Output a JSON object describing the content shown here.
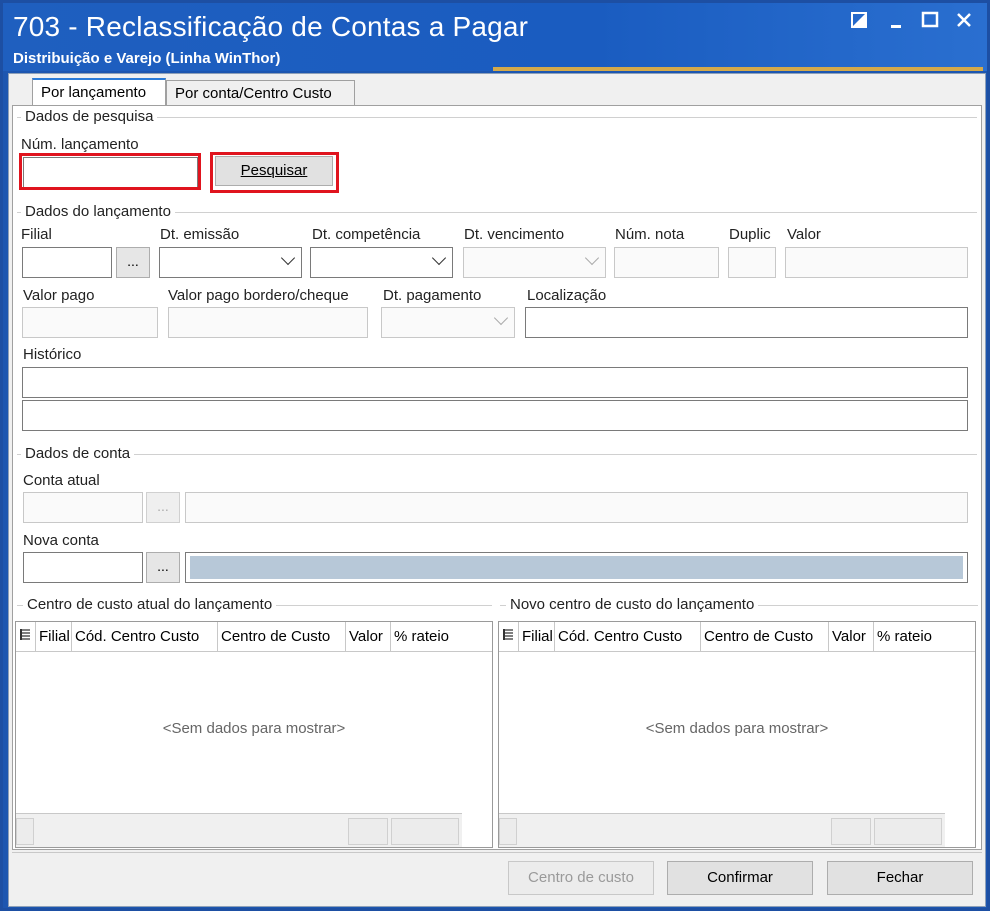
{
  "window": {
    "title": "703 - Reclassificação de Contas a Pagar",
    "subtitle": "Distribuição e Varejo (Linha WinThor)"
  },
  "tabs": [
    {
      "label": "Por lançamento"
    },
    {
      "label": "Por conta/Centro Custo"
    }
  ],
  "search": {
    "group": "Dados de pesquisa",
    "num_label": "Núm. lançamento",
    "num_value": "",
    "button": "Pesquisar"
  },
  "launch": {
    "group": "Dados do lançamento",
    "filial": "Filial",
    "emissao": "Dt. emissão",
    "competencia": "Dt. competência",
    "vencimento": "Dt. vencimento",
    "num_nota": "Núm. nota",
    "duplic": "Duplic",
    "valor": "Valor",
    "valor_pago": "Valor pago",
    "valor_bordero": "Valor pago bordero/cheque",
    "dt_pagamento": "Dt. pagamento",
    "localizacao": "Localização",
    "historico": "Histórico",
    "dots": "..."
  },
  "account": {
    "group": "Dados de conta",
    "atual": "Conta atual",
    "nova": "Nova conta"
  },
  "cc_atual": {
    "group": "Centro de custo atual do lançamento",
    "columns": [
      "Filial",
      "Cód. Centro Custo",
      "Centro de Custo",
      "Valor",
      "% rateio"
    ],
    "empty": "<Sem dados para mostrar>"
  },
  "cc_novo": {
    "group": "Novo centro de custo do lançamento",
    "columns": [
      "Filial",
      "Cód. Centro Custo",
      "Centro de Custo",
      "Valor",
      "% rateio"
    ],
    "empty": "<Sem dados para mostrar>"
  },
  "footer": {
    "centro": "Centro de custo",
    "confirmar": "Confirmar",
    "fechar": "Fechar"
  },
  "icons": [
    "restore-icon",
    "minimize-icon",
    "maximize-icon",
    "close-icon",
    "column-chooser-icon",
    "chevron-down-icon"
  ]
}
